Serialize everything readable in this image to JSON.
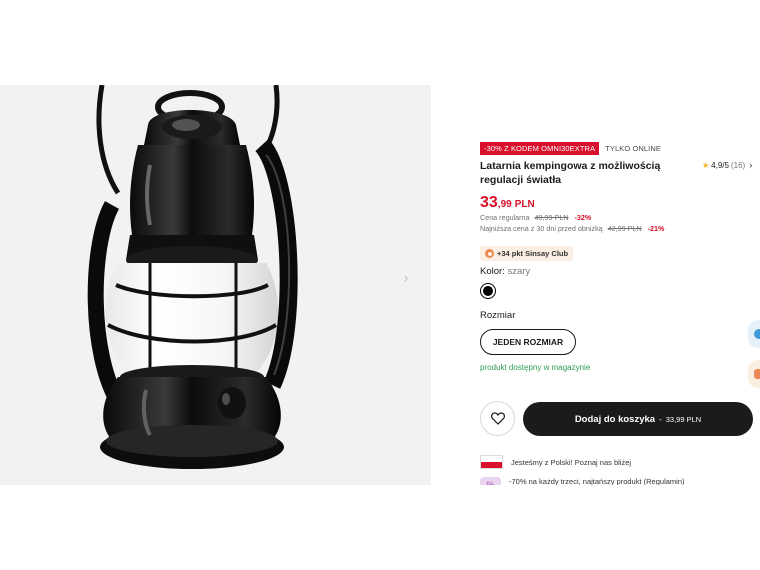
{
  "gallery": {
    "image_icon": "lantern-product-photo",
    "next_icon": "chevron-right-icon"
  },
  "product": {
    "promo_badge": "-30% Z KODEM OMNI30EXTRA",
    "online_badge": "TYLKO ONLINE",
    "title": "Latarnia kempingowa z możliwością regulacji światła",
    "rating": {
      "star_icon": "star-icon",
      "value": "4,9/5",
      "count": "(16)",
      "chevron": "›"
    },
    "price": {
      "integer": "33",
      "decimal": ",99",
      "currency": "PLN"
    },
    "regular_price": {
      "label": "Cena regularna",
      "value": "49,99 PLN",
      "discount": "-32%"
    },
    "lowest_price": {
      "label": "Najniższa cena z 30 dni przed obniżką",
      "value": "42,99 PLN",
      "discount": "-21%"
    },
    "club": {
      "icon": "coin-icon",
      "label": "+34 pkt Sinsay Club"
    },
    "color": {
      "label": "Kolor:",
      "value": "szary",
      "swatch_color": "#000000"
    },
    "size": {
      "label": "Rozmiar",
      "value": "JEDEN ROZMIAR"
    },
    "availability": "produkt dostępny w magazynie",
    "add_to_cart": {
      "label": "Dodaj do koszyka",
      "separator": "-",
      "amount": "33,99 PLN"
    },
    "favorite_icon": "heart-icon",
    "benefits": [
      {
        "icon": "polish-flag-icon",
        "text": "Jesteśmy z Polski! Poznaj nas bliżej"
      },
      {
        "icon": "tag-icon",
        "text": "-70% na każdy trzeci, najtańszy produkt (Regulamin)"
      }
    ]
  },
  "colors": {
    "accent_red": "#d8102b",
    "available_green": "#2e9e4f",
    "dark": "#1b1b1b",
    "club_bg": "#fbeee3"
  }
}
